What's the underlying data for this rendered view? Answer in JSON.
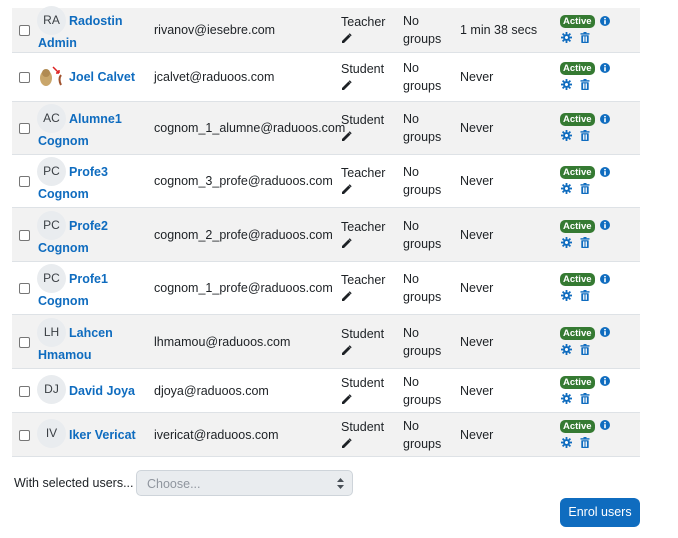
{
  "users": [
    {
      "initials": "RA",
      "first": "Radostin",
      "last": "Admin",
      "email": "rivanov@iesebre.com",
      "role": "Teacher",
      "groups": [
        "No",
        "groups"
      ],
      "last_access": "1 min 38 secs",
      "status": "Active",
      "avatar": "initials"
    },
    {
      "initials": "",
      "first": "Joel Calvet",
      "last": "",
      "email": "jcalvet@raduoos.com",
      "role": "Student",
      "groups": [
        "No",
        "groups"
      ],
      "last_access": "Never",
      "status": "Active",
      "avatar": "picture"
    },
    {
      "initials": "AC",
      "first": "Alumne1",
      "last": "Cognom",
      "email": "cognom_1_alumne@raduoos.com",
      "role": "Student",
      "groups": [
        "No",
        "groups"
      ],
      "last_access": "Never",
      "status": "Active",
      "avatar": "initials"
    },
    {
      "initials": "PC",
      "first": "Profe3",
      "last": "Cognom",
      "email": "cognom_3_profe@raduoos.com",
      "role": "Teacher",
      "groups": [
        "No",
        "groups"
      ],
      "last_access": "Never",
      "status": "Active",
      "avatar": "initials"
    },
    {
      "initials": "PC",
      "first": "Profe2",
      "last": "Cognom",
      "email": "cognom_2_profe@raduoos.com",
      "role": "Teacher",
      "groups": [
        "No",
        "groups"
      ],
      "last_access": "Never",
      "status": "Active",
      "avatar": "initials"
    },
    {
      "initials": "PC",
      "first": "Profe1",
      "last": "Cognom",
      "email": "cognom_1_profe@raduoos.com",
      "role": "Teacher",
      "groups": [
        "No",
        "groups"
      ],
      "last_access": "Never",
      "status": "Active",
      "avatar": "initials"
    },
    {
      "initials": "LH",
      "first": "Lahcen",
      "last": "Hmamou",
      "email": "lhmamou@raduoos.com",
      "role": "Student",
      "groups": [
        "No",
        "groups"
      ],
      "last_access": "Never",
      "status": "Active",
      "avatar": "initials"
    },
    {
      "initials": "DJ",
      "first": "David Joya",
      "last": "",
      "email": "djoya@raduoos.com",
      "role": "Student",
      "groups": [
        "No",
        "groups"
      ],
      "last_access": "Never",
      "status": "Active",
      "avatar": "initials"
    },
    {
      "initials": "IV",
      "first": "Iker Vericat",
      "last": "",
      "email": "ivericat@raduoos.com",
      "role": "Student",
      "groups": [
        "No",
        "groups"
      ],
      "last_access": "Never",
      "status": "Active",
      "avatar": "initials"
    }
  ],
  "bulk": {
    "label": "With selected users...",
    "placeholder": "Choose..."
  },
  "enrol_button": "Enrol users",
  "icons": {
    "role_edit": "pencil-icon",
    "status_info": "info-icon",
    "edit": "cog-icon",
    "remove": "trash-icon",
    "select": "checkbox"
  },
  "colors": {
    "link": "#0f6cbf",
    "badge": "#357a32",
    "button": "#0f6cbf",
    "stripe": "#f2f2f2"
  }
}
